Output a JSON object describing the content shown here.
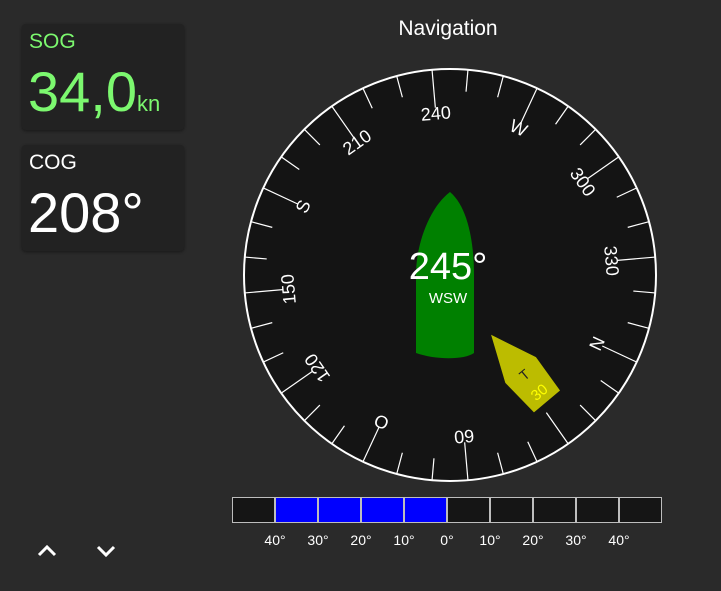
{
  "sog": {
    "label": "SOG",
    "value": "34,0",
    "unit": "kn"
  },
  "cog": {
    "label": "COG",
    "value": "208°"
  },
  "navigation": {
    "title": "Navigation",
    "heading": "245°",
    "heading_dir": "WSW",
    "rotation_deg": 245,
    "dial_labels": [
      {
        "deg": 240,
        "text": "240"
      },
      {
        "deg": 270,
        "text": "W"
      },
      {
        "deg": 300,
        "text": "300"
      },
      {
        "deg": 330,
        "text": "330"
      },
      {
        "deg": 0,
        "text": "N"
      },
      {
        "deg": 60,
        "text": "60"
      },
      {
        "deg": 90,
        "text": "O"
      },
      {
        "deg": 120,
        "text": "120"
      },
      {
        "deg": 150,
        "text": "150"
      },
      {
        "deg": 180,
        "text": "S"
      },
      {
        "deg": 210,
        "text": "210"
      }
    ],
    "wind": {
      "label": "T",
      "value": "30",
      "color": "#bcbc00"
    },
    "boat_color": "#008000"
  },
  "scale": {
    "labels": [
      "40°",
      "30°",
      "20°",
      "10°",
      "0°",
      "10°",
      "20°",
      "30°",
      "40°"
    ],
    "active": [
      false,
      true,
      true,
      true,
      true,
      false,
      false,
      false,
      false,
      false
    ],
    "active_color": "#0000ff"
  },
  "nav": {
    "up_icon": "chevron-up-icon",
    "down_icon": "chevron-down-icon"
  }
}
